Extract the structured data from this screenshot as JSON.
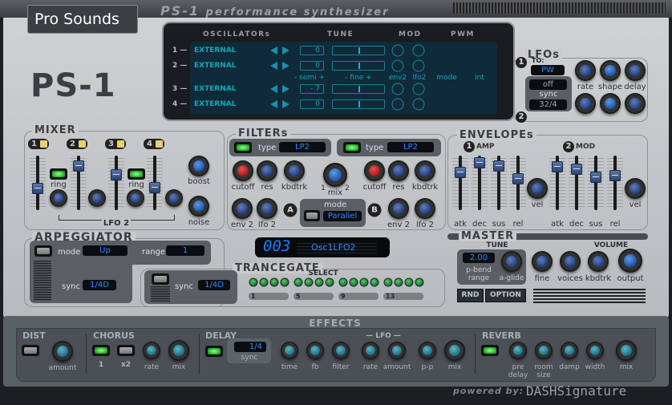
{
  "header": {
    "brand": "Pro Sounds",
    "title": "PS-1",
    "subtitle": "performance synthesizer",
    "logo": "PS-1"
  },
  "oscillators": {
    "title": "OSCILLATORs",
    "tune": "TUNE",
    "mod": "MOD",
    "pwm": "PWM",
    "rows": [
      {
        "num": "1 —",
        "source": "EXTERNAL",
        "semi": "0"
      },
      {
        "num": "2 —",
        "source": "EXTERNAL",
        "semi": "0"
      },
      {
        "num": "3 —",
        "source": "EXTERNAL",
        "semi": "- 7"
      },
      {
        "num": "4 —",
        "source": "EXTERNAL",
        "semi": "0"
      }
    ],
    "sub": {
      "semi": "- semi +",
      "fine": "-   fine   +",
      "env2": "env2",
      "lfo2": "lfo2",
      "mode": "mode",
      "int": "int"
    }
  },
  "lfos": {
    "title": "LFOs",
    "one": "1",
    "two": "2",
    "to": "TO:",
    "to_value": "PW",
    "sync_label": "sync",
    "sync1": "off",
    "sync2": "32/4",
    "rate": "rate",
    "shape": "shape",
    "delay": "delay"
  },
  "mixer": {
    "title": "MIXER",
    "channels": [
      "1",
      "2",
      "3",
      "4"
    ],
    "ring": "ring",
    "lfo2": "LFO 2",
    "boost": "boost",
    "noise": "noise"
  },
  "filters": {
    "title": "FILTERs",
    "type_label": "type",
    "type1": "LP2",
    "type2": "LP2",
    "cutoff": "cutoff",
    "res": "res",
    "kbdtrk": "kbdtrk",
    "env2": "env 2",
    "lfo2": "lfo 2",
    "mix": "mix",
    "mix_min": "1",
    "mix_max": "2",
    "mode_label": "mode",
    "mode": "Parallel",
    "a": "A",
    "b": "B"
  },
  "envelopes": {
    "title": "ENVELOPEs",
    "amp": "AMP",
    "mod": "MOD",
    "one": "1",
    "two": "2",
    "atk": "atk",
    "dec": "dec",
    "sus": "sus",
    "rel": "rel",
    "vel": "vel"
  },
  "arpeggiator": {
    "title": "ARPEGGIATOR",
    "mode_label": "mode",
    "mode": "Up",
    "range_label": "range",
    "range": "1",
    "sync_label": "sync",
    "sync": "1/4D"
  },
  "lcd": {
    "number": "003",
    "preset": "Osc1LFO2"
  },
  "trancegate": {
    "title": "TRANCEGATE",
    "sync_label": "sync",
    "sync": "1/4D",
    "select": "SELECT",
    "markers": [
      "1",
      "5",
      "9",
      "13"
    ]
  },
  "master": {
    "title": "MASTER",
    "tune": "TUNE",
    "volume": "VOLUME",
    "pbend": "2.00",
    "pbend_label1": "p-bend",
    "pbend_label2": "range",
    "aglide": "a-glide",
    "fine": "fine",
    "voices": "voices",
    "kbdtrk": "kbdtrk",
    "output": "output",
    "rnd": "RND",
    "option": "OPTION"
  },
  "effects": {
    "title": "EFFECTS",
    "dist": "DIST",
    "amount": "amount",
    "chorus": "CHORUS",
    "one": "1",
    "x2": "x2",
    "rate": "rate",
    "mix": "mix",
    "delay": "DELAY",
    "sync_value": "1/4",
    "sync": "sync",
    "time": "time",
    "fb": "fb",
    "filter": "filter",
    "lfo": "— LFO —",
    "lfo_rate": "rate",
    "lfo_amount": "amount",
    "pp": "p-p",
    "delay_mix": "mix",
    "reverb": "REVERB",
    "pre1": "pre",
    "pre2": "delay",
    "room1": "room",
    "room2": "size",
    "damp": "damp",
    "width": "width",
    "reverb_mix": "mix"
  },
  "footer": {
    "powered": "powered by:",
    "brand": "DASHSignature"
  },
  "colors": {
    "panel": "#c4c7ca",
    "display": "#0f2a38",
    "accent": "#2e8bff",
    "effects": "#4a5056"
  }
}
